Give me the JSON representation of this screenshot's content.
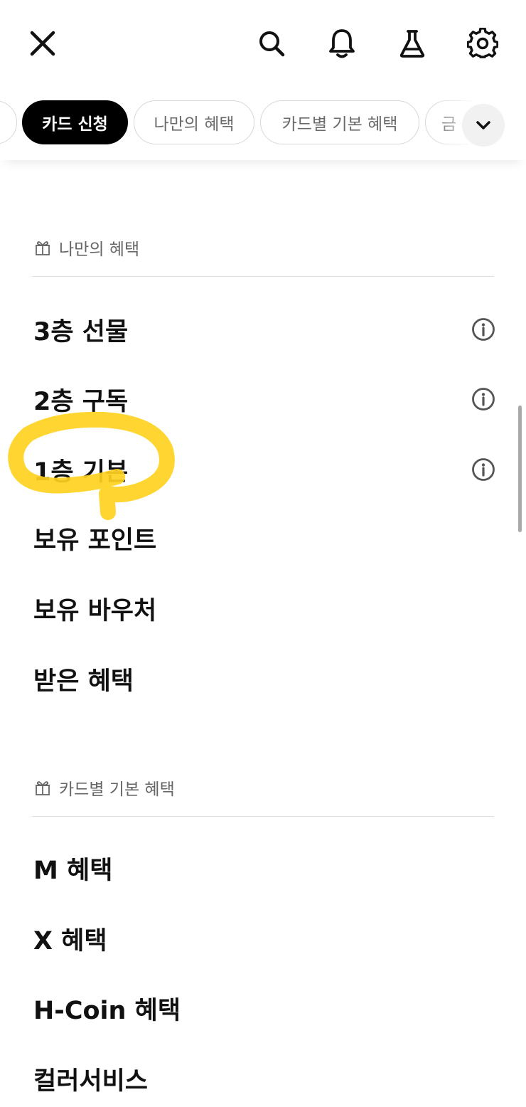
{
  "topbar": {
    "close_icon": "close-icon",
    "search_icon": "search-icon",
    "notification_icon": "bell-icon",
    "lab_icon": "flask-icon",
    "settings_icon": "gear-icon"
  },
  "chips": {
    "items": [
      {
        "label": "",
        "state": "partially-visible"
      },
      {
        "label": "카드 신청",
        "active": true
      },
      {
        "label": "나만의 혜택",
        "active": false
      },
      {
        "label": "카드별 기본 혜택",
        "active": false
      },
      {
        "label": "금",
        "state": "partially-visible"
      }
    ],
    "expand_icon": "chevron-down-icon"
  },
  "sections": [
    {
      "title": "나만의 혜택",
      "icon": "gift-icon",
      "items": [
        {
          "label": "3층 선물",
          "info_icon": "info-icon"
        },
        {
          "label": "2층 구독",
          "info_icon": "info-icon"
        },
        {
          "label": "1층 기본",
          "info_icon": "info-icon",
          "highlighted": true
        },
        {
          "label": "보유 포인트"
        },
        {
          "label": "보유 바우처"
        },
        {
          "label": "받은 혜택"
        }
      ]
    },
    {
      "title": "카드별 기본 혜택",
      "icon": "gift-icon",
      "items": [
        {
          "label": "M 혜택"
        },
        {
          "label": "X 혜택"
        },
        {
          "label": "H-Coin 혜택"
        },
        {
          "label": "컬러서비스",
          "state": "partially-visible"
        }
      ]
    }
  ],
  "colors": {
    "active_chip_bg": "#000000",
    "highlight": "#FFD21F",
    "divider": "#dcdcdc",
    "muted_text": "#666666"
  }
}
